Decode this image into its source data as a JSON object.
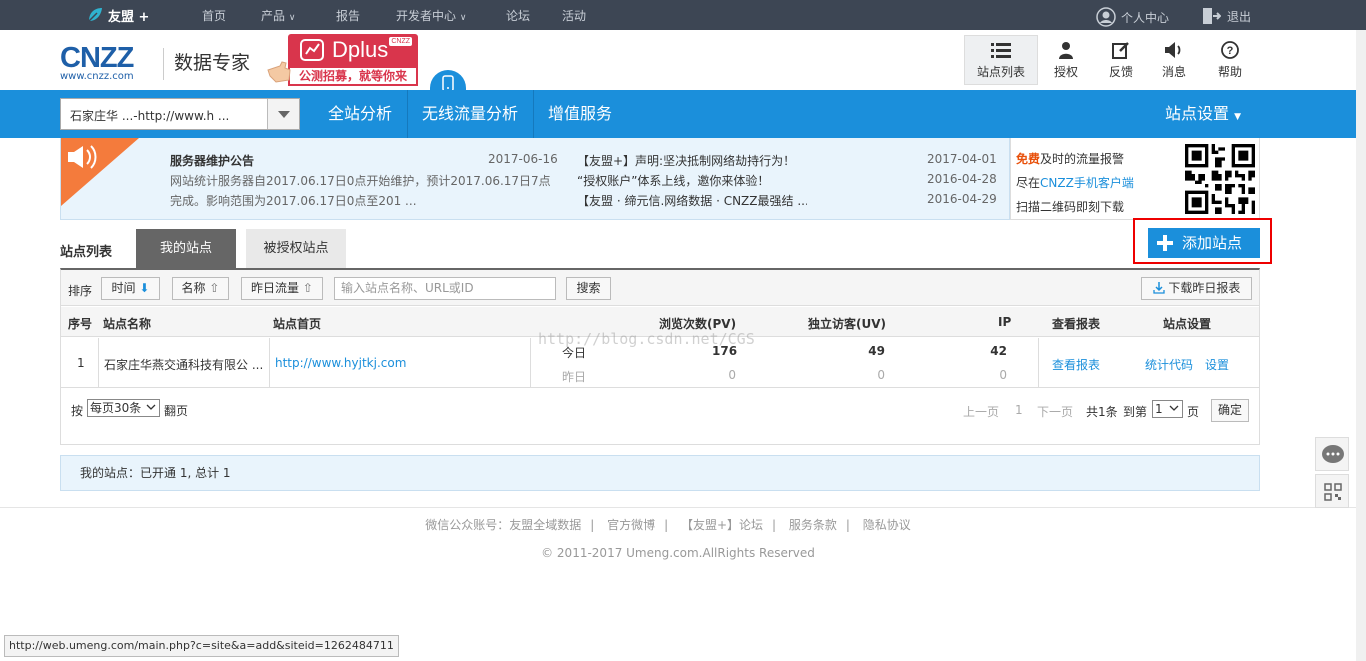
{
  "topnav": {
    "logo": "友盟 +",
    "items": [
      "首页",
      "产品",
      "报告",
      "开发者中心",
      "论坛",
      "活动"
    ],
    "user_center": "个人中心",
    "logout": "退出"
  },
  "header": {
    "cnzz_big": "CNZZ",
    "cnzz_small": "www.cnzz.com",
    "brand_title": "数据专家",
    "dplus_title": "Dplus",
    "dplus_tag": "CNZZ",
    "dplus_slogan": "公测招募，就等你来",
    "icons": [
      "站点列表",
      "授权",
      "反馈",
      "消息",
      "帮助"
    ]
  },
  "bluebar": {
    "site_select": "石家庄华 ...-http://www.h ...",
    "nav": [
      "全站分析",
      "无线流量分析",
      "增值服务"
    ],
    "site_settings": "站点设置"
  },
  "notice": {
    "title": "服务器维护公告",
    "title_date": "2017-06-16",
    "body": "网站统计服务器自2017.06.17日0点开始维护，预计2017.06.17日7点完成。影响范围为2017.06.17日0点至201 ...",
    "news": [
      {
        "text": "【友盟+】声明:坚决抵制网络劫持行为！",
        "date": "2017-04-01"
      },
      {
        "text": "“授权账户”体系上线，邀你来体验！",
        "date": "2016-04-28"
      },
      {
        "text": "【友盟 · 缔元信.网络数据 · CNZZ最强结 ...",
        "date": "2016-04-29"
      }
    ]
  },
  "qr": {
    "line1_red": "免费",
    "line1_rest": "及时的流量报警",
    "line2_prefix": "尽在",
    "line2_link": "CNZZ手机客户端",
    "line3": "扫描二维码即刻下载"
  },
  "tabs": {
    "label": "站点列表",
    "mine": "我的站点",
    "authorized": "被授权站点",
    "add_button": "添加站点"
  },
  "toolbar": {
    "sort_label": "排序",
    "sort_time": "时间",
    "sort_name": "名称",
    "sort_traffic": "昨日流量",
    "search_placeholder": "输入站点名称、URL或ID",
    "search_button": "搜索",
    "download": "下载昨日报表"
  },
  "table": {
    "headers": [
      "序号",
      "站点名称",
      "站点首页",
      "浏览次数(PV)",
      "独立访客(UV)",
      "IP",
      "查看报表",
      "站点设置"
    ],
    "row": {
      "index": "1",
      "name": "石家庄华燕交通科技有限公 ...",
      "url": "http://www.hyjtkj.com",
      "today_label": "今日",
      "yesterday_label": "昨日",
      "pv_today": "176",
      "pv_yesterday": "0",
      "uv_today": "49",
      "uv_yesterday": "0",
      "ip_today": "42",
      "ip_yesterday": "0",
      "view_report": "查看报表",
      "stat_code": "统计代码",
      "settings": "设置"
    }
  },
  "pager": {
    "by": "按",
    "per_page": "每页30条",
    "flip": "翻页",
    "prev": "上一页",
    "current": "1",
    "next": "下一页",
    "total": "共1条",
    "goto": "到第",
    "goto_value": "1",
    "page_unit": "页",
    "confirm": "确定"
  },
  "summary": "我的站点：已开通 1, 总计 1",
  "footer": {
    "links": [
      "微信公众账号：友盟全域数据",
      "官方微博",
      "【友盟+】论坛",
      "服务条款",
      "隐私协议"
    ],
    "copyright": "© 2011-2017 Umeng.com.AllRights Reserved"
  },
  "statusbar": "http://web.umeng.com/main.php?c=site&a=add&siteid=1262484711",
  "watermark": "http://blog.csdn.net/CGS"
}
